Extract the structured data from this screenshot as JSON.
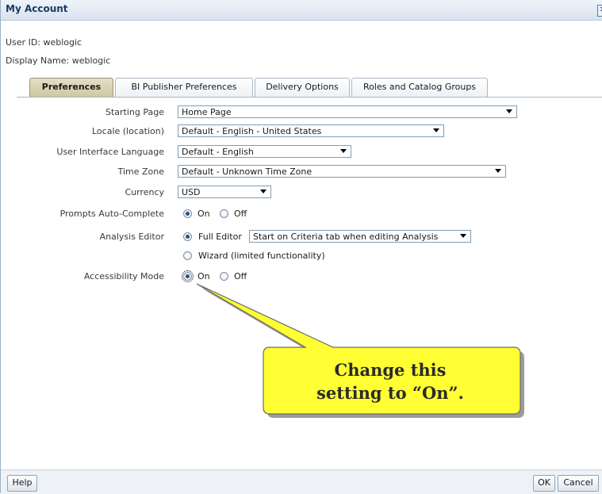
{
  "dialog": {
    "title": "My Account"
  },
  "user": {
    "user_id": "User ID: weblogic",
    "display_name": "Display Name: weblogic"
  },
  "tabs": [
    {
      "label": "Preferences",
      "active": true
    },
    {
      "label": "BI Publisher Preferences",
      "active": false
    },
    {
      "label": "Delivery Options",
      "active": false
    },
    {
      "label": "Roles and Catalog Groups",
      "active": false
    }
  ],
  "prefs": {
    "starting_page": {
      "label": "Starting Page",
      "value": "Home Page"
    },
    "locale": {
      "label": "Locale (location)",
      "value": "Default - English - United States"
    },
    "ui_language": {
      "label": "User Interface Language",
      "value": "Default - English"
    },
    "time_zone": {
      "label": "Time Zone",
      "value": "Default - Unknown Time Zone"
    },
    "currency": {
      "label": "Currency",
      "value": "USD"
    },
    "prompts_autocomplete": {
      "label": "Prompts Auto-Complete",
      "on": "On",
      "off": "Off",
      "selected": "On"
    },
    "analysis_editor": {
      "label": "Analysis Editor",
      "full_editor": "Full Editor",
      "full_editor_option": "Start on Criteria tab when editing Analysis",
      "wizard": "Wizard (limited functionality)",
      "selected": "Full Editor"
    },
    "accessibility_mode": {
      "label": "Accessibility Mode",
      "on": "On",
      "off": "Off",
      "selected": "On"
    }
  },
  "callout": {
    "line1": "Change this",
    "line2": "setting to “On”."
  },
  "footer": {
    "help": "Help",
    "ok": "OK",
    "cancel": "Cancel"
  },
  "colors": {
    "callout_fill": "#ffff33",
    "title": "#1a3a64",
    "active_tab": "#cfc6a3"
  }
}
